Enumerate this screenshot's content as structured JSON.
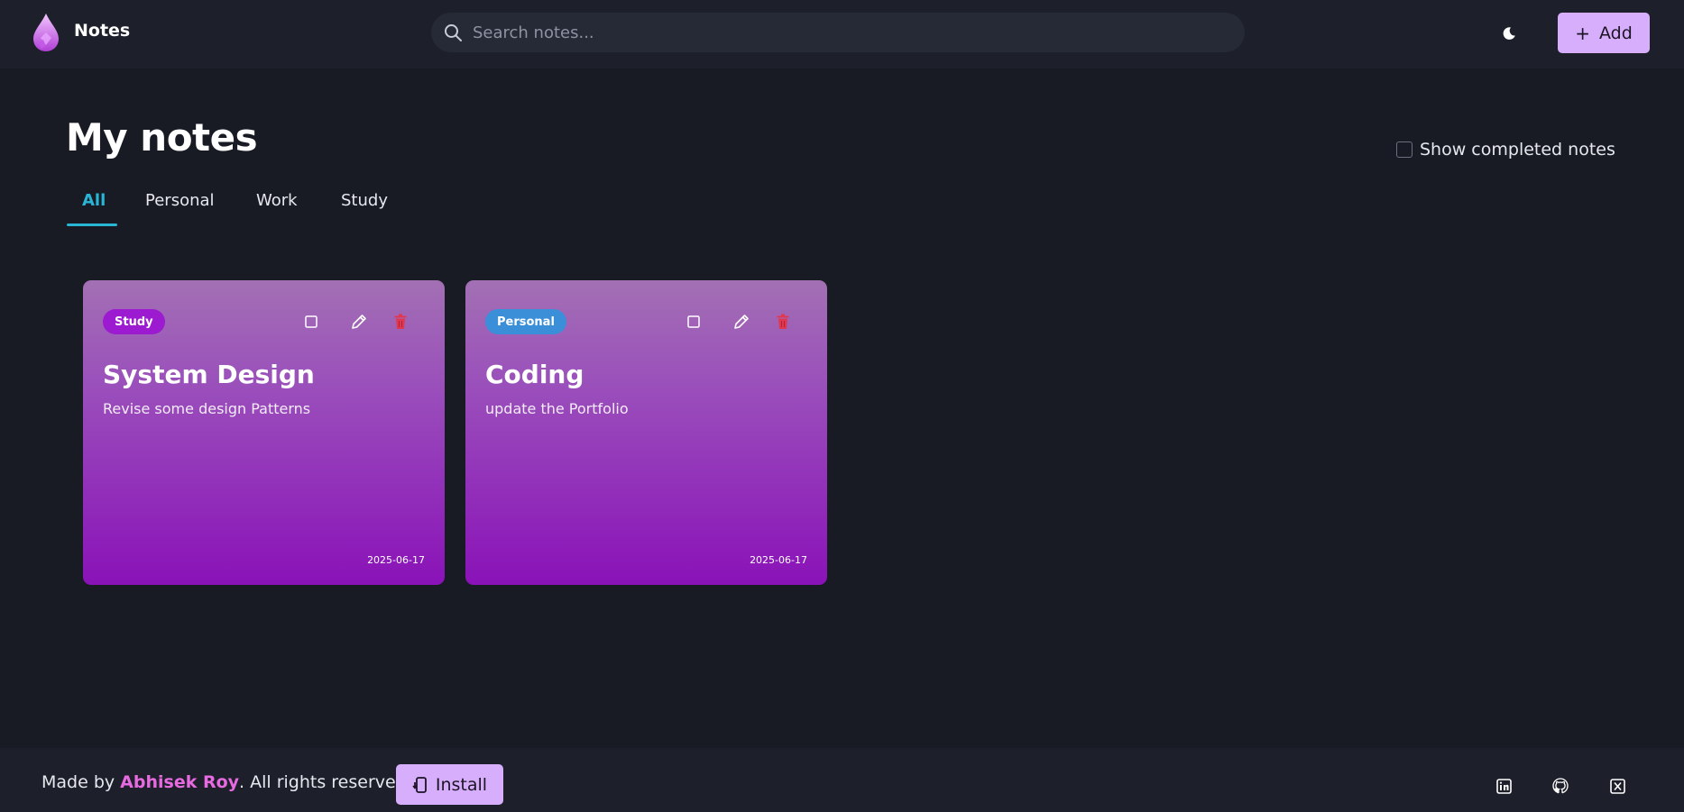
{
  "app": {
    "name": "Notes",
    "accent": "#d7aefb",
    "background": "#191b24",
    "surface": "#1d202b",
    "logo_icon": "droplet-logo-icon"
  },
  "header": {
    "search_placeholder": "Search notes...",
    "search_icon": "search-icon",
    "theme_icon": "moon-icon",
    "add_label": "Add",
    "add_icon": "plus-icon"
  },
  "main": {
    "title": "My notes",
    "tabs": [
      {
        "label": "All",
        "active": true
      },
      {
        "label": "Personal",
        "active": false
      },
      {
        "label": "Work",
        "active": false
      },
      {
        "label": "Study",
        "active": false
      }
    ],
    "show_completed": {
      "label": "Show completed notes",
      "checked": false
    },
    "active_tab_color": "#29b6d6"
  },
  "notes": [
    {
      "tag": "Study",
      "tag_color": "#9c1ad0",
      "title": "System Design",
      "description": "Revise some design Patterns",
      "date": "2025-06-17",
      "completed": false
    },
    {
      "tag": "Personal",
      "tag_color": "#3b8fd8",
      "title": "Coding",
      "description": "update the Portfolio",
      "date": "2025-06-17",
      "completed": false
    }
  ],
  "footer": {
    "credit_prefix": "Made by ",
    "author": "Abhisek Roy",
    "credit_suffix": ". All rights reserved",
    "author_color": "#e86ae0",
    "install_label": "Install",
    "install_icon": "install-app-icon",
    "social": [
      "linkedin-icon",
      "github-icon",
      "x-twitter-icon"
    ]
  }
}
